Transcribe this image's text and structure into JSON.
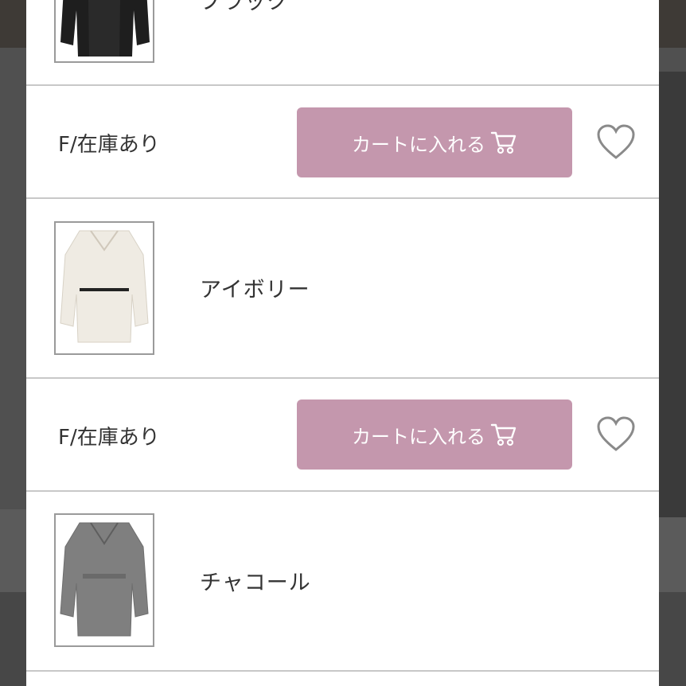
{
  "colors": {
    "cart_button_bg": "#c497ad",
    "cart_button_text": "#ffffff",
    "divider": "#c8c8c8",
    "heart_stroke": "#8a8a8a"
  },
  "variants": [
    {
      "color_name": "ブラック",
      "stock_text": "F/在庫あり",
      "cart_label": "カートに入れる",
      "icons": [
        "cart-icon",
        "heart-icon"
      ]
    },
    {
      "color_name": "アイボリー",
      "stock_text": "F/在庫あり",
      "cart_label": "カートに入れる",
      "icons": [
        "cart-icon",
        "heart-icon"
      ]
    },
    {
      "color_name": "チャコール",
      "icons": []
    }
  ]
}
